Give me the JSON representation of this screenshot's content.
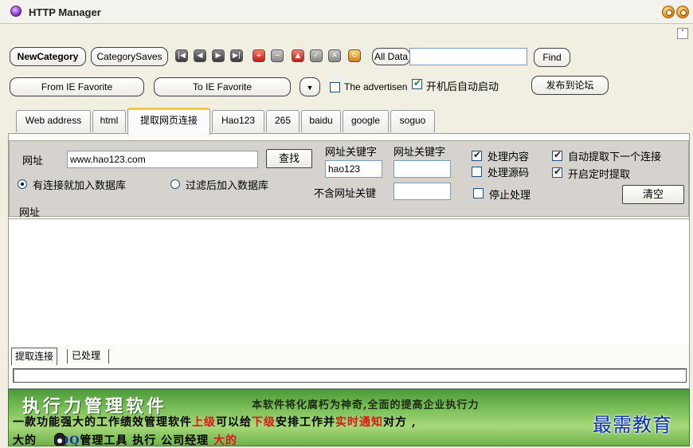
{
  "window": {
    "title": "HTTP Manager"
  },
  "toolbar1": {
    "new_category": "NewCategory",
    "category_saves": "CategorySaves",
    "all_data": "All Data",
    "search_value": "",
    "find": "Find"
  },
  "toolbar2": {
    "from_ie": "From IE Favorite",
    "to_ie": "To IE Favorite",
    "advertise_label": "The advertisen",
    "autostart_label": "开机后自动启动",
    "publish": "发布到论坛"
  },
  "tabs": [
    "Web address",
    "html",
    "提取网页连接",
    "Hao123",
    "265",
    "baidu",
    "google",
    "soguo"
  ],
  "form": {
    "url_label": "网址",
    "url_value": "www.hao123.com",
    "search_button": "查找",
    "kw1_label": "网址关键字",
    "kw1_value": "hao123",
    "kw2_label": "网址关键字",
    "kw2_value": "",
    "exclude_label": "不含网址关键",
    "exclude_value": "",
    "radio1": "有连接就加入数据库",
    "radio2": "过滤后加入数据库",
    "process_content": "处理内容",
    "process_source": "处理源码",
    "stop_process": "停止处理",
    "auto_next": "自动提取下一个连接",
    "timed_extract": "开启定时提取",
    "clear": "清空",
    "list_header": "网址"
  },
  "subtabs": [
    "提取连接",
    "已处理"
  ],
  "banner": {
    "title": "执行力管理软件",
    "tagline": "本软件将化腐朽为神奇,全面的提高企业执行力",
    "line2": [
      "一款功能强大的工作绩效管理软件",
      "上级",
      "可以给",
      "下级",
      "安排工作并",
      "实时通知",
      "对方 ,"
    ],
    "line3": [
      "大的",
      "QQ",
      "管理工具",
      "执行",
      "公司经理",
      "大的"
    ],
    "watermark": "最需教育"
  },
  "icons": [
    "first-icon",
    "prev-icon",
    "next-icon",
    "last-icon",
    "add-icon",
    "remove-icon",
    "up-icon",
    "check-icon",
    "delete-icon",
    "refresh-icon"
  ]
}
